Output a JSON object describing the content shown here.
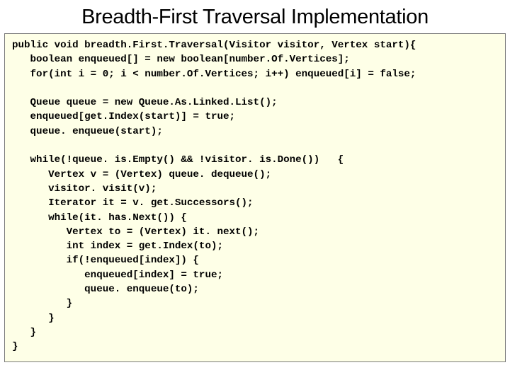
{
  "title": "Breadth-First Traversal Implementation",
  "code": "public void breadth.First.Traversal(Visitor visitor, Vertex start){\n   boolean enqueued[] = new boolean[number.Of.Vertices];\n   for(int i = 0; i < number.Of.Vertices; i++) enqueued[i] = false;\n\n   Queue queue = new Queue.As.Linked.List();\n   enqueued[get.Index(start)] = true;\n   queue. enqueue(start);\n\n   while(!queue. is.Empty() && !visitor. is.Done())   {\n      Vertex v = (Vertex) queue. dequeue();\n      visitor. visit(v);\n      Iterator it = v. get.Successors();\n      while(it. has.Next()) {\n         Vertex to = (Vertex) it. next();\n         int index = get.Index(to);\n         if(!enqueued[index]) {\n            enqueued[index] = true;\n            queue. enqueue(to);\n         }\n      }\n   }\n}"
}
